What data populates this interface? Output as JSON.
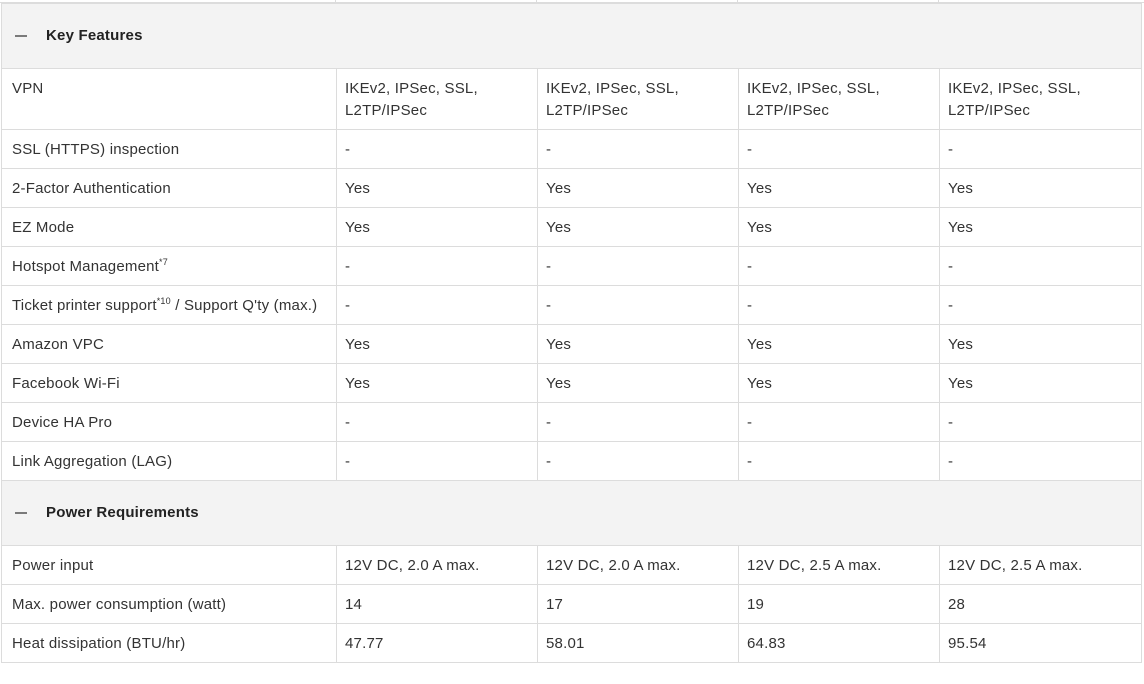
{
  "sections": [
    {
      "title": "Key Features",
      "rows": [
        {
          "label": "VPN",
          "values": [
            "IKEv2, IPSec, SSL, L2TP/IPSec",
            "IKEv2, IPSec, SSL, L2TP/IPSec",
            "IKEv2, IPSec, SSL, L2TP/IPSec",
            "IKEv2, IPSec, SSL, L2TP/IPSec"
          ]
        },
        {
          "label": "SSL (HTTPS) inspection",
          "values": [
            "-",
            "-",
            "-",
            "-"
          ]
        },
        {
          "label": "2-Factor Authentication",
          "values": [
            "Yes",
            "Yes",
            "Yes",
            "Yes"
          ]
        },
        {
          "label": "EZ Mode",
          "values": [
            "Yes",
            "Yes",
            "Yes",
            "Yes"
          ]
        },
        {
          "label": "Hotspot Management",
          "sup": "*7",
          "values": [
            "-",
            "-",
            "-",
            "-"
          ]
        },
        {
          "label": "Ticket printer support",
          "sup": "*10",
          "label_suffix": " / Support Q'ty (max.)",
          "values": [
            "-",
            "-",
            "-",
            "-"
          ]
        },
        {
          "label": "Amazon VPC",
          "values": [
            "Yes",
            "Yes",
            "Yes",
            "Yes"
          ]
        },
        {
          "label": "Facebook Wi-Fi",
          "values": [
            "Yes",
            "Yes",
            "Yes",
            "Yes"
          ]
        },
        {
          "label": "Device HA Pro",
          "values": [
            "-",
            "-",
            "-",
            "-"
          ]
        },
        {
          "label": "Link Aggregation (LAG)",
          "values": [
            "-",
            "-",
            "-",
            "-"
          ]
        }
      ]
    },
    {
      "title": "Power Requirements",
      "rows": [
        {
          "label": "Power input",
          "values": [
            "12V DC, 2.0 A max.",
            "12V DC, 2.0 A max.",
            "12V DC, 2.5 A max.",
            "12V DC, 2.5 A max."
          ]
        },
        {
          "label": "Max. power consumption (watt)",
          "values": [
            "14",
            "17",
            "19",
            "28"
          ]
        },
        {
          "label": "Heat dissipation (BTU/hr)",
          "values": [
            "47.77",
            "58.01",
            "64.83",
            "95.54"
          ]
        }
      ]
    }
  ],
  "icons": {
    "collapse": "minus-icon"
  },
  "colors": {
    "section_bg": "#f3f3f3",
    "border": "#dcdcdc",
    "text": "#333333"
  }
}
